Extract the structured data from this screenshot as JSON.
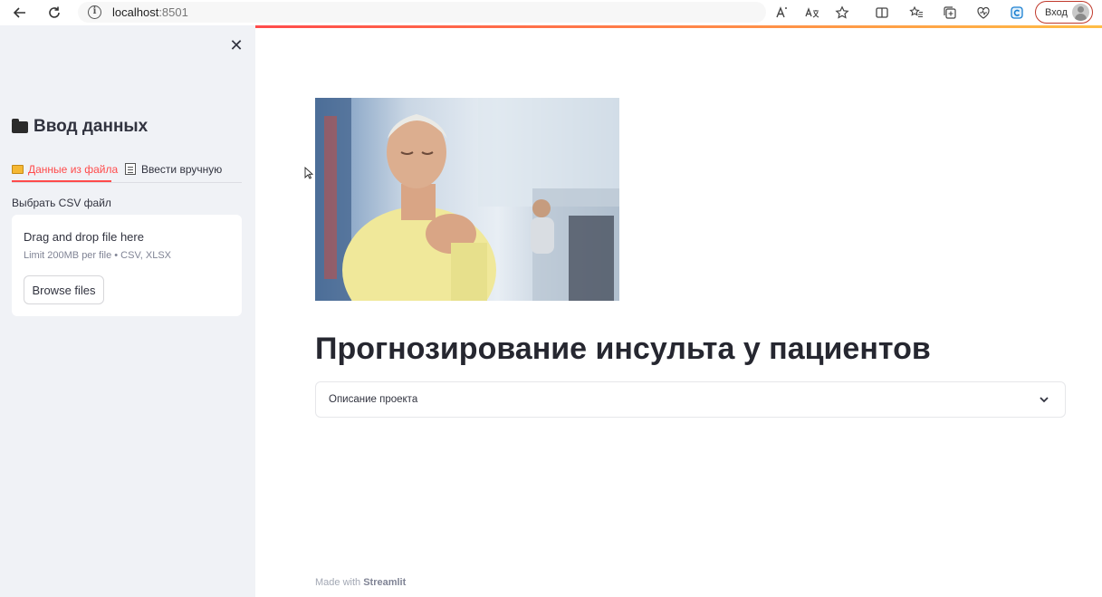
{
  "browser": {
    "url_host": "localhost",
    "url_port": ":8501",
    "login_label": "Вход"
  },
  "sidebar": {
    "title": "Ввод данных",
    "tabs": [
      {
        "label": "Данные из файла",
        "active": true
      },
      {
        "label": "Ввести вручную",
        "active": false
      }
    ],
    "uploader": {
      "label": "Выбрать CSV файл",
      "drop_text": "Drag and drop file here",
      "limit_text": "Limit 200MB per file • CSV, XLSX",
      "browse_label": "Browse files"
    }
  },
  "main": {
    "title": "Прогнозирование инсульта у пациентов",
    "expander_label": "Описание проекта",
    "footer_prefix": "Made with",
    "footer_brand": "Streamlit"
  },
  "colors": {
    "accent": "#ff4b4b",
    "sidebar_bg": "#f0f2f6",
    "text": "#31333f"
  }
}
